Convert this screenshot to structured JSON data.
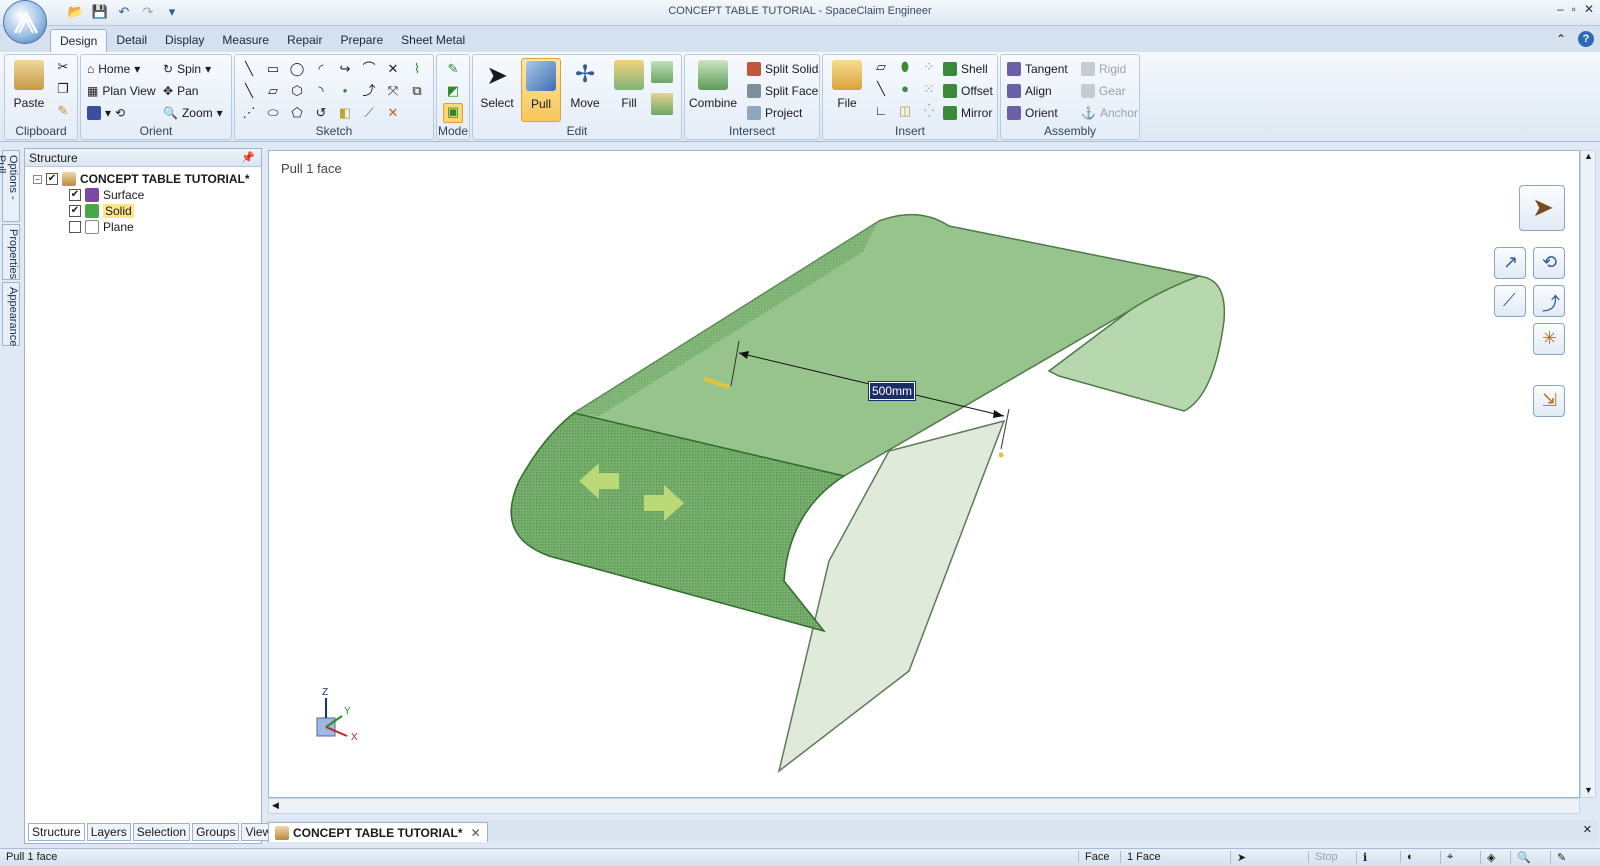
{
  "window": {
    "title": "CONCEPT TABLE TUTORIAL - SpaceClaim Engineer"
  },
  "ribbon": {
    "tabs": [
      "Design",
      "Detail",
      "Display",
      "Measure",
      "Repair",
      "Prepare",
      "Sheet Metal"
    ],
    "clipboard": {
      "paste": "Paste",
      "label": "Clipboard"
    },
    "orient": {
      "home": "Home",
      "spin": "Spin",
      "plan_view": "Plan View",
      "pan": "Pan",
      "zoom": "Zoom",
      "label": "Orient"
    },
    "sketch": {
      "label": "Sketch"
    },
    "mode": {
      "label": "Mode"
    },
    "edit": {
      "select": "Select",
      "pull": "Pull",
      "move": "Move",
      "fill": "Fill",
      "label": "Edit"
    },
    "intersect": {
      "combine": "Combine",
      "split_solid": "Split Solid",
      "split_face": "Split Face",
      "project": "Project",
      "label": "Intersect"
    },
    "insert": {
      "file": "File",
      "shell": "Shell",
      "offset": "Offset",
      "mirror": "Mirror",
      "label": "Insert"
    },
    "assembly": {
      "tangent": "Tangent",
      "align": "Align",
      "orient": "Orient",
      "rigid": "Rigid",
      "gear": "Gear",
      "anchor": "Anchor",
      "label": "Assembly"
    }
  },
  "side_tabs": [
    "Options - Pull",
    "Properties",
    "Appearance"
  ],
  "structure": {
    "title": "Structure",
    "root": "CONCEPT TABLE TUTORIAL*",
    "items": [
      {
        "label": "Surface",
        "checked": "✔"
      },
      {
        "label": "Solid",
        "checked": "✔"
      },
      {
        "label": "Plane",
        "checked": ""
      }
    ],
    "bottom_tabs": [
      "Structure",
      "Layers",
      "Selection",
      "Groups",
      "Views"
    ]
  },
  "viewport": {
    "hint": "Pull 1 face",
    "dimension": "500mm",
    "axes": {
      "x": "X",
      "y": "Y",
      "z": "Z"
    }
  },
  "document_tab": {
    "label": "CONCEPT TABLE TUTORIAL*"
  },
  "status": {
    "text": "Pull 1 face",
    "mode": "Face",
    "selection": "1 Face",
    "stop": "Stop"
  },
  "colors": {
    "accent": "#f8c65a",
    "solid_green": "#7fb57a",
    "dimension_bg": "#1b2f66"
  }
}
